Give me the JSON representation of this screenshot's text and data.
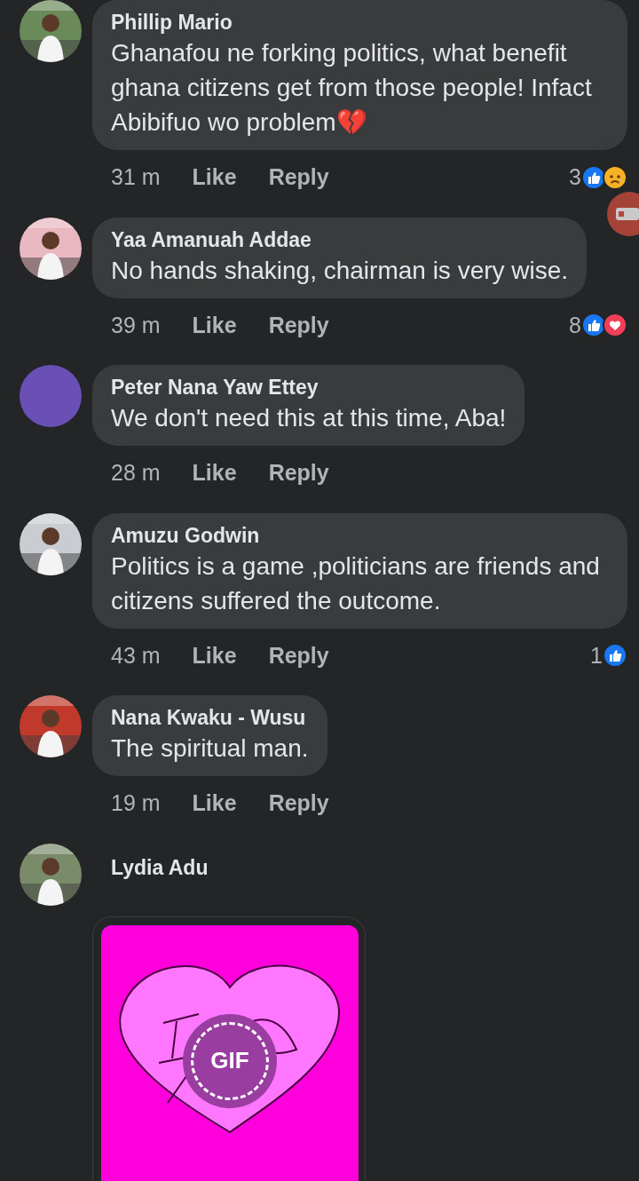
{
  "comments": [
    {
      "name": "Phillip Mario",
      "text": "Ghanafou ne forking politics, what benefit ghana citizens get from those people! Infact Abibifuo wo problem💔",
      "time": "31 m",
      "like": "Like",
      "reply": "Reply",
      "reaction_count": "3",
      "reactions": [
        {
          "kind": "like"
        },
        {
          "kind": "sad"
        }
      ]
    },
    {
      "name": "Yaa Amanuah Addae",
      "text": "No hands shaking, chairman is very wise.",
      "time": "39 m",
      "like": "Like",
      "reply": "Reply",
      "reaction_count": "8",
      "reactions": [
        {
          "kind": "like"
        },
        {
          "kind": "love"
        }
      ]
    },
    {
      "name": "Peter Nana Yaw Ettey",
      "text": "We don't need this at this time, Aba!",
      "time": "28 m",
      "like": "Like",
      "reply": "Reply"
    },
    {
      "name": "Amuzu Godwin",
      "text": "Politics is a game ,politicians are friends and citizens suffered the outcome.",
      "time": "43 m",
      "like": "Like",
      "reply": "Reply",
      "reaction_count": "1",
      "reactions": [
        {
          "kind": "like"
        }
      ]
    },
    {
      "name": "Nana Kwaku - Wusu",
      "text": "The spiritual man.",
      "time": "19 m",
      "like": "Like",
      "reply": "Reply"
    },
    {
      "name": "Lydia Adu",
      "gif": {
        "badge": "GIF"
      }
    }
  ]
}
